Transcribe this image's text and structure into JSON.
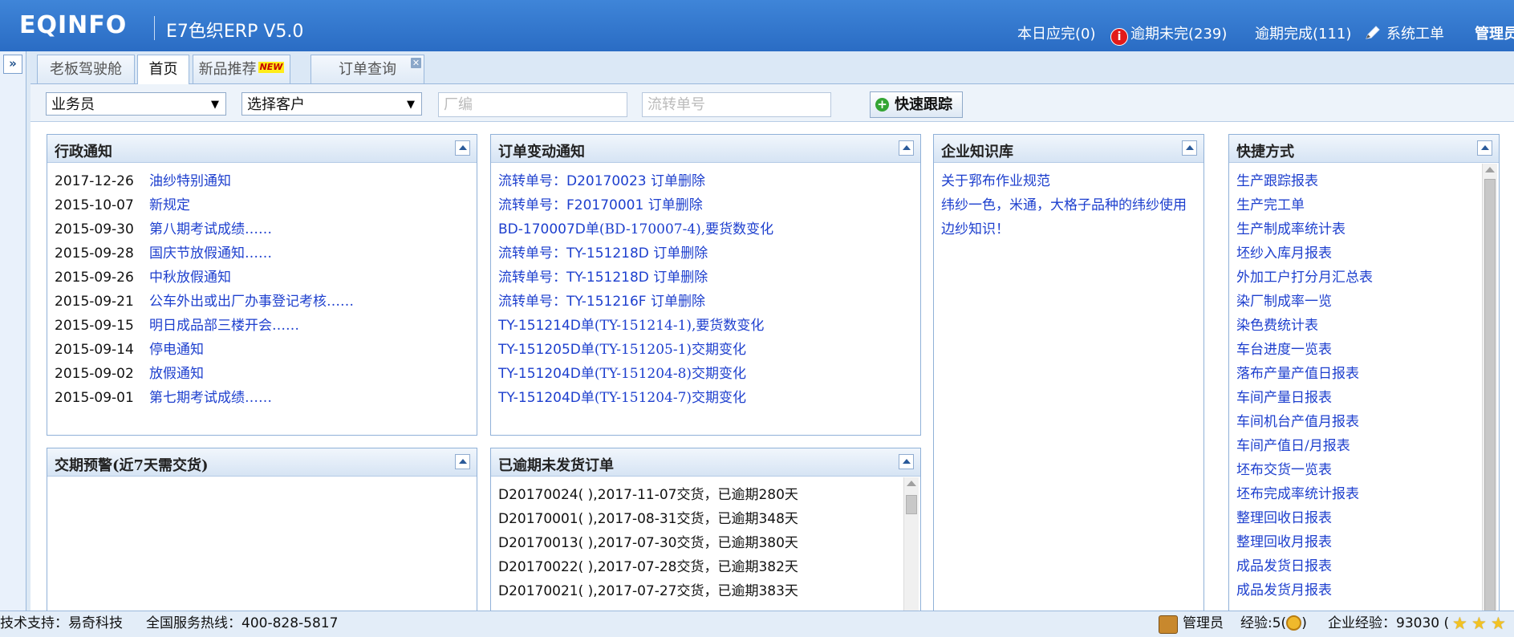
{
  "header": {
    "logo": "EQINFO",
    "app_title": "E7色织ERP V5.0",
    "links": {
      "today_due": "本日应完(0)",
      "overdue_unfinished": "逾期未完(239)",
      "overdue_completed": "逾期完成(111)",
      "system_ticket": "系统工单",
      "admin": "管理员"
    }
  },
  "tabs": [
    {
      "label": "老板驾驶舱"
    },
    {
      "label": "首页"
    },
    {
      "label": "新品推荐",
      "badge": "NEW"
    },
    {
      "label": "订单查询"
    }
  ],
  "search": {
    "salesman": "业务员",
    "customer": "选择客户",
    "factory_code_placeholder": "厂编",
    "flow_no_placeholder": "流转单号",
    "quick_track": "快速跟踪"
  },
  "admin_notice": {
    "title": "行政通知",
    "items": [
      {
        "date": "2017-12-26",
        "text": "油纱特别通知"
      },
      {
        "date": "2015-10-07",
        "text": "新规定"
      },
      {
        "date": "2015-09-30",
        "text": "第八期考试成绩……"
      },
      {
        "date": "2015-09-28",
        "text": "国庆节放假通知……"
      },
      {
        "date": "2015-09-26",
        "text": "中秋放假通知"
      },
      {
        "date": "2015-09-21",
        "text": "公车外出或出厂办事登记考核……"
      },
      {
        "date": "2015-09-15",
        "text": "明日成品部三楼开会……"
      },
      {
        "date": "2015-09-14",
        "text": "停电通知"
      },
      {
        "date": "2015-09-02",
        "text": "放假通知"
      },
      {
        "date": "2015-09-01",
        "text": "第七期考试成绩……"
      }
    ]
  },
  "order_change": {
    "title": "订单变动通知",
    "items": [
      {
        "prefix": "流转单号：",
        "code": "D20170023",
        "suffix": " 订单删除"
      },
      {
        "prefix": "流转单号：",
        "code": "F20170001",
        "suffix": " 订单删除"
      },
      {
        "prefix": "",
        "code": "BD-170007D",
        "suffix": "单(BD-170007-4),要货数变化"
      },
      {
        "prefix": "流转单号：",
        "code": "TY-151218D",
        "suffix": " 订单删除"
      },
      {
        "prefix": "流转单号：",
        "code": "TY-151218D",
        "suffix": " 订单删除"
      },
      {
        "prefix": "流转单号：",
        "code": "TY-151216F",
        "suffix": " 订单删除"
      },
      {
        "prefix": "",
        "code": "TY-151214D",
        "suffix": "单(TY-151214-1),要货数变化"
      },
      {
        "prefix": "",
        "code": "TY-151205D",
        "suffix": "单(TY-151205-1)交期变化"
      },
      {
        "prefix": "",
        "code": "TY-151204D",
        "suffix": "单(TY-151204-8)交期变化"
      },
      {
        "prefix": "",
        "code": "TY-151204D",
        "suffix": "单(TY-151204-7)交期变化"
      }
    ]
  },
  "knowledge": {
    "title": "企业知识库",
    "items": [
      "关于郛布作业规范",
      "纬纱一色，米通，大格子品种的纬纱使用",
      "边纱知识！"
    ]
  },
  "shortcuts": {
    "title": "快捷方式",
    "items": [
      "生产跟踪报表",
      "生产完工单",
      "生产制成率统计表",
      "坯纱入库月报表",
      "外加工户打分月汇总表",
      "染厂制成率一览",
      "染色费统计表",
      "车台进度一览表",
      "落布产量产值日报表",
      "车间产量日报表",
      "车间机台产值月报表",
      "车间产值日/月报表",
      "坯布交货一览表",
      "坯布完成率统计报表",
      "整理回收日报表",
      "整理回收月报表",
      "成品发货日报表",
      "成品发货月报表"
    ]
  },
  "delivery_warning": {
    "title": "交期预警(近7天需交货)"
  },
  "overdue_orders": {
    "title": "已逾期未发货订单",
    "items": [
      "D20170024( ),2017-11-07交货，已逾期280天",
      "D20170001( ),2017-08-31交货，已逾期348天",
      "D20170013( ),2017-07-30交货，已逾期380天",
      "D20170022( ),2017-07-28交货，已逾期382天",
      "D20170021( ),2017-07-27交货，已逾期383天"
    ]
  },
  "footer": {
    "support": "技术支持：易奇科技",
    "hotline": "全国服务热线：400-828-5817",
    "user": "管理员",
    "experience": "经验:5(",
    "experience_close": ")",
    "enterprise_experience": "企业经验：93030 ("
  },
  "colors": {
    "header_blue": "#2f75cf",
    "link_blue": "#1d3fce",
    "panel_border": "#90b1d8"
  }
}
